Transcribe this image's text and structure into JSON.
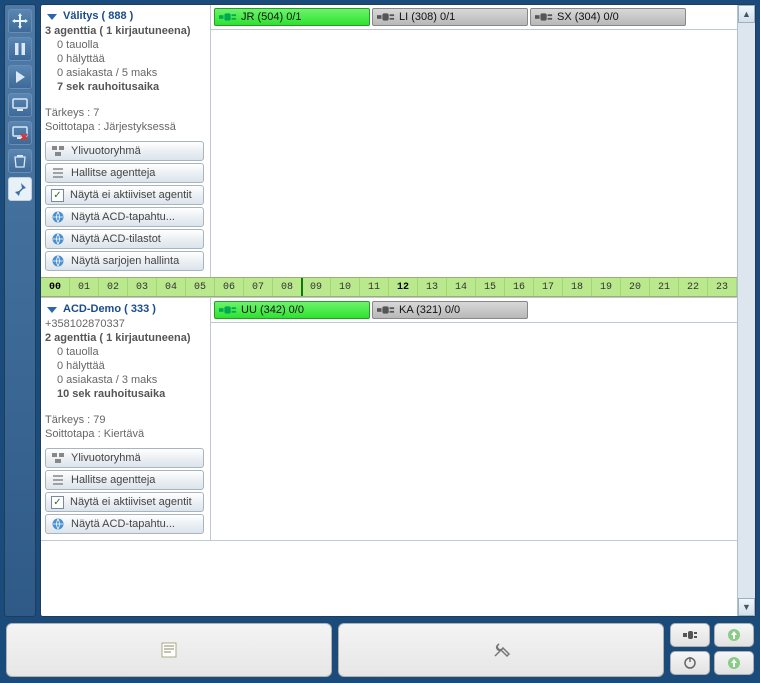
{
  "toolbar": {
    "icons": [
      "move",
      "pause",
      "play",
      "monitor",
      "monitor-x",
      "trash",
      "pin"
    ]
  },
  "groups": [
    {
      "title": "Välitys ( 888 )",
      "subtitle": "3 agenttia ( 1 kirjautuneena)",
      "phone": "",
      "stats": {
        "paused": "0 tauolla",
        "alerting": "0 hälyttää",
        "customers": "0 asiakasta / 5 maks",
        "cooldown": "7 sek rauhoitusaika"
      },
      "meta": {
        "priority": "Tärkeys : 7",
        "callmode": "Soittotapa : Järjestyksessä"
      },
      "buttons": {
        "overflow": "Ylivuotoryhmä",
        "manage": "Hallitse agentteja",
        "showInactive": "Näytä ei aktiiviset agentit",
        "showAcdEvents": "Näytä ACD-tapahtu...",
        "showAcdStats": "Näytä ACD-tilastot",
        "showSeriesMgmt": "Näytä sarjojen hallinta"
      },
      "agents": [
        {
          "label": "JR (504)  0/1",
          "state": "green"
        },
        {
          "label": "LI (308)  0/1",
          "state": "gray"
        },
        {
          "label": "SX (304)  0/0",
          "state": "gray"
        }
      ]
    },
    {
      "title": "ACD-Demo ( 333 )",
      "subtitle": "2 agenttia ( 1 kirjautuneena)",
      "phone": "+358102870337",
      "stats": {
        "paused": "0 tauolla",
        "alerting": "0 hälyttää",
        "customers": "0 asiakasta / 3 maks",
        "cooldown": "10 sek rauhoitusaika"
      },
      "meta": {
        "priority": "Tärkeys : 79",
        "callmode": "Soittotapa : Kiertävä"
      },
      "buttons": {
        "overflow": "Ylivuotoryhmä",
        "manage": "Hallitse agentteja",
        "showInactive": "Näytä ei aktiiviset agentit",
        "showAcdEvents": "Näytä ACD-tapahtu..."
      },
      "agents": [
        {
          "label": "UU (342)  0/0",
          "state": "green"
        },
        {
          "label": "KA (321)  0/0",
          "state": "gray"
        }
      ]
    }
  ],
  "timeline": {
    "hours": [
      "00",
      "01",
      "02",
      "03",
      "04",
      "05",
      "06",
      "07",
      "08",
      "09",
      "10",
      "11",
      "12",
      "13",
      "14",
      "15",
      "16",
      "17",
      "18",
      "19",
      "20",
      "21",
      "22",
      "23"
    ],
    "boldHours": [
      "00",
      "12"
    ],
    "markAfter": "08"
  },
  "bottom": {
    "leftIcon": "notes",
    "midIcon": "tools",
    "btns": [
      "plug",
      "up",
      "power",
      "up2"
    ]
  }
}
